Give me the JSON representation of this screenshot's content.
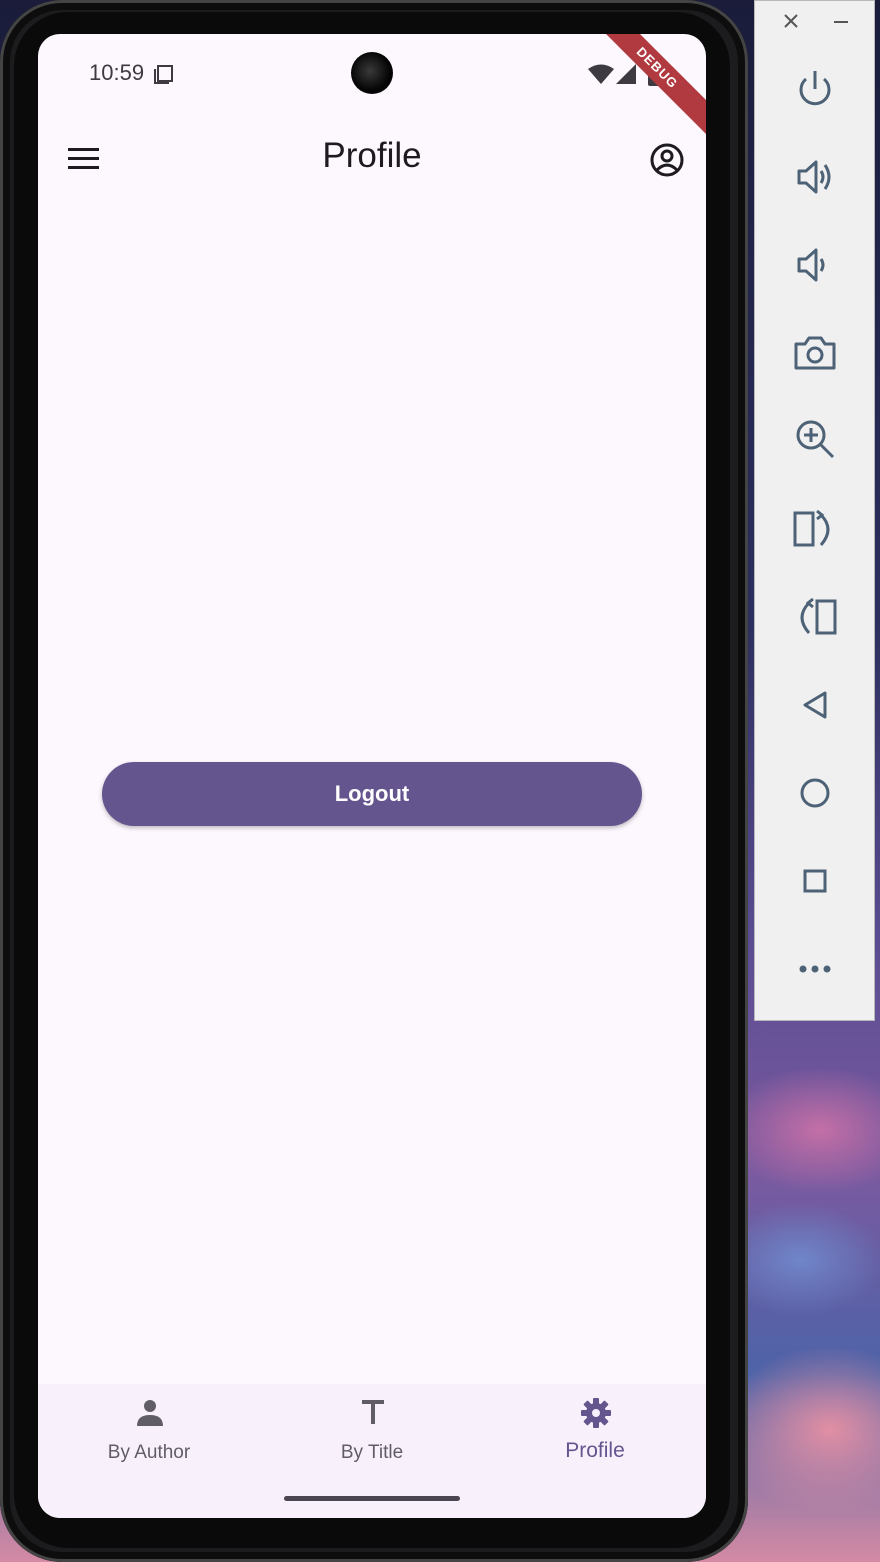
{
  "status_bar": {
    "time": "10:59",
    "debug_label": "DEBUG"
  },
  "app_bar": {
    "title": "Profile",
    "menu_icon": "menu-icon",
    "account_icon": "account-circle-icon"
  },
  "main": {
    "logout_label": "Logout"
  },
  "bottom_nav": {
    "items": [
      {
        "label": "By Author",
        "icon": "person-icon",
        "active": false
      },
      {
        "label": "By Title",
        "icon": "title-icon",
        "active": false
      },
      {
        "label": "Profile",
        "icon": "gear-icon",
        "active": true
      }
    ]
  },
  "emulator_toolbar": {
    "buttons": [
      "power-icon",
      "volume-up-icon",
      "volume-down-icon",
      "camera-icon",
      "zoom-icon",
      "rotate-left-icon",
      "rotate-right-icon",
      "back-icon",
      "home-icon",
      "overview-icon",
      "more-icon"
    ]
  },
  "colors": {
    "primary": "#65558f",
    "surface": "#fdf7fe",
    "nav_surface": "#f8f1fb",
    "debug_ribbon": "#b03a3f"
  }
}
